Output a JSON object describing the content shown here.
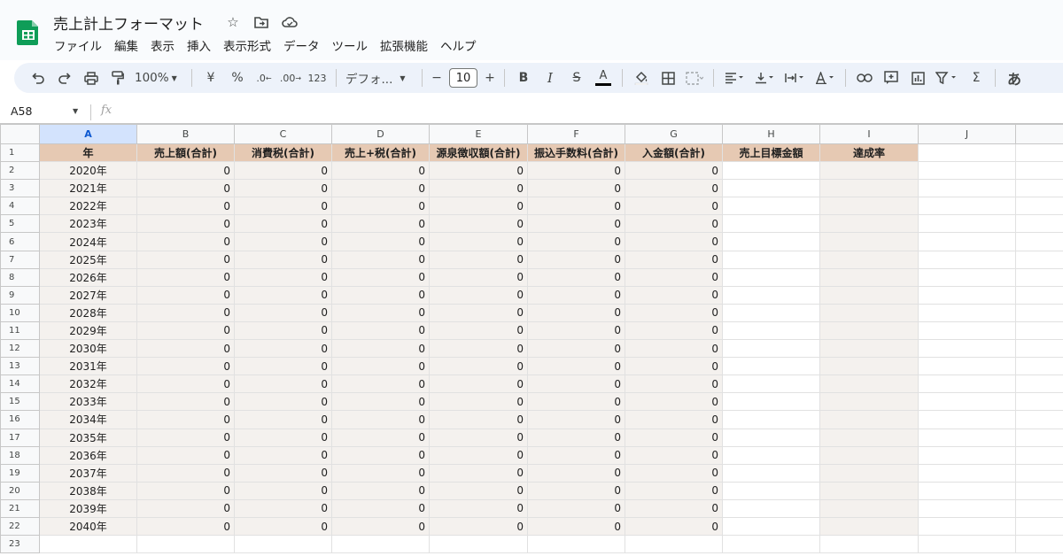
{
  "app": {
    "title": "売上計上フォーマット",
    "menu": [
      "ファイル",
      "編集",
      "表示",
      "挿入",
      "表示形式",
      "データ",
      "ツール",
      "拡張機能",
      "ヘルプ"
    ]
  },
  "toolbar": {
    "zoom": "100%",
    "currency": "¥",
    "percent": "%",
    "dec_decrease": ".0",
    "dec_increase": ".00",
    "number_format": "123",
    "font": "デフォ...",
    "minus": "−",
    "font_size": "10",
    "plus": "+",
    "bold": "B",
    "italic": "I",
    "strike": "S",
    "text_color": "A",
    "sigma": "Σ",
    "input_tool": "あ"
  },
  "formula_bar": {
    "cell_ref": "A58",
    "fx": "fx"
  },
  "sheet": {
    "columns": [
      "A",
      "B",
      "C",
      "D",
      "E",
      "F",
      "G",
      "H",
      "I",
      "J"
    ],
    "headers": [
      "年",
      "売上額(合計)",
      "消費税(合計)",
      "売上+税(合計)",
      "源泉徴収額(合計)",
      "振込手数料(合計)",
      "入金額(合計)",
      "売上目標金額",
      "達成率"
    ],
    "rows": [
      {
        "year": "2020年",
        "values": [
          "0",
          "0",
          "0",
          "0",
          "0",
          "0"
        ]
      },
      {
        "year": "2021年",
        "values": [
          "0",
          "0",
          "0",
          "0",
          "0",
          "0"
        ]
      },
      {
        "year": "2022年",
        "values": [
          "0",
          "0",
          "0",
          "0",
          "0",
          "0"
        ]
      },
      {
        "year": "2023年",
        "values": [
          "0",
          "0",
          "0",
          "0",
          "0",
          "0"
        ]
      },
      {
        "year": "2024年",
        "values": [
          "0",
          "0",
          "0",
          "0",
          "0",
          "0"
        ]
      },
      {
        "year": "2025年",
        "values": [
          "0",
          "0",
          "0",
          "0",
          "0",
          "0"
        ]
      },
      {
        "year": "2026年",
        "values": [
          "0",
          "0",
          "0",
          "0",
          "0",
          "0"
        ]
      },
      {
        "year": "2027年",
        "values": [
          "0",
          "0",
          "0",
          "0",
          "0",
          "0"
        ]
      },
      {
        "year": "2028年",
        "values": [
          "0",
          "0",
          "0",
          "0",
          "0",
          "0"
        ]
      },
      {
        "year": "2029年",
        "values": [
          "0",
          "0",
          "0",
          "0",
          "0",
          "0"
        ]
      },
      {
        "year": "2030年",
        "values": [
          "0",
          "0",
          "0",
          "0",
          "0",
          "0"
        ]
      },
      {
        "year": "2031年",
        "values": [
          "0",
          "0",
          "0",
          "0",
          "0",
          "0"
        ]
      },
      {
        "year": "2032年",
        "values": [
          "0",
          "0",
          "0",
          "0",
          "0",
          "0"
        ]
      },
      {
        "year": "2033年",
        "values": [
          "0",
          "0",
          "0",
          "0",
          "0",
          "0"
        ]
      },
      {
        "year": "2034年",
        "values": [
          "0",
          "0",
          "0",
          "0",
          "0",
          "0"
        ]
      },
      {
        "year": "2035年",
        "values": [
          "0",
          "0",
          "0",
          "0",
          "0",
          "0"
        ]
      },
      {
        "year": "2036年",
        "values": [
          "0",
          "0",
          "0",
          "0",
          "0",
          "0"
        ]
      },
      {
        "year": "2037年",
        "values": [
          "0",
          "0",
          "0",
          "0",
          "0",
          "0"
        ]
      },
      {
        "year": "2038年",
        "values": [
          "0",
          "0",
          "0",
          "0",
          "0",
          "0"
        ]
      },
      {
        "year": "2039年",
        "values": [
          "0",
          "0",
          "0",
          "0",
          "0",
          "0"
        ]
      },
      {
        "year": "2040年",
        "values": [
          "0",
          "0",
          "0",
          "0",
          "0",
          "0"
        ]
      }
    ],
    "row_numbers": [
      "1",
      "2",
      "3",
      "4",
      "5",
      "6",
      "7",
      "8",
      "9",
      "10",
      "11",
      "12",
      "13",
      "14",
      "15",
      "16",
      "17",
      "18",
      "19",
      "20",
      "21",
      "22",
      "23"
    ]
  },
  "colors": {
    "header_fill": "#e6c9b3",
    "data_fill": "#f4f1ee",
    "selected_column": "#d3e3fd",
    "app_green": "#0f9d58"
  },
  "icons": [
    "sheets-logo-icon",
    "star-icon",
    "move-folder-icon",
    "cloud-saved-icon",
    "undo-icon",
    "redo-icon",
    "print-icon",
    "paint-format-icon",
    "fill-color-icon",
    "borders-icon",
    "merge-cells-icon",
    "align-left-icon",
    "valign-bottom-icon",
    "text-wrap-icon",
    "text-rotate-icon",
    "link-icon",
    "comment-icon",
    "chart-icon",
    "filter-icon"
  ]
}
